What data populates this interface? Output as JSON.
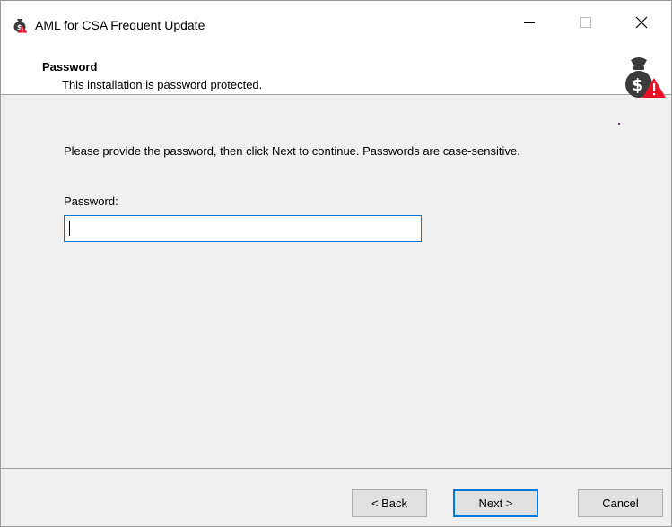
{
  "window": {
    "title": "AML for CSA Frequent Update",
    "app_icon": "money-bag-warning-icon"
  },
  "header": {
    "title": "Password",
    "subtitle": "This installation is password protected.",
    "logo_icon": "money-bag-warning-icon"
  },
  "content": {
    "instructions": "Please provide the password, then click Next to continue. Passwords are case-sensitive.",
    "password_label": "Password:",
    "password_value": "",
    "password_placeholder": ""
  },
  "buttons": {
    "back": "< Back",
    "next": "Next >",
    "cancel": "Cancel"
  },
  "colors": {
    "accent": "#0078d7",
    "warning": "#e81123"
  }
}
